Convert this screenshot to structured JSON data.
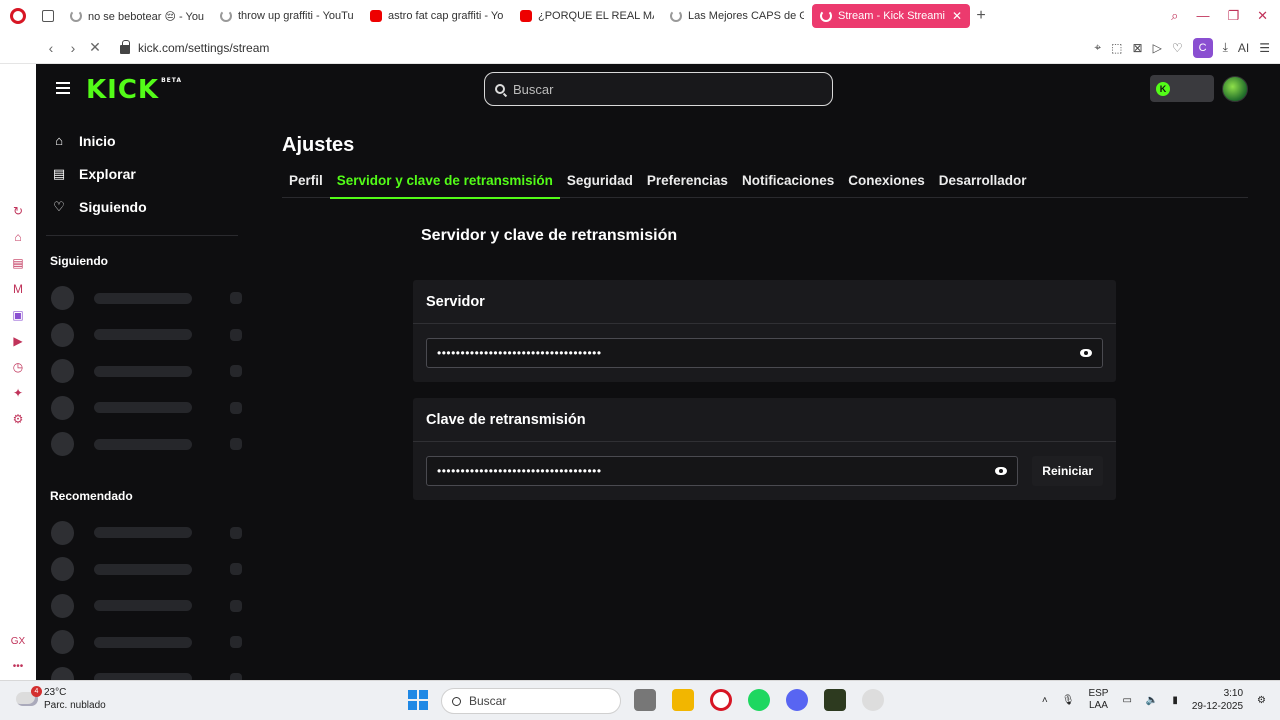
{
  "browser": {
    "tabs": [
      {
        "title": "no se bebotear 😔 - You",
        "icon": "spinner-icon",
        "active": false
      },
      {
        "title": "throw up graffiti - YouTu",
        "icon": "spinner-icon",
        "active": false
      },
      {
        "title": "astro fat cap graffiti - Yo",
        "icon": "youtube-icon",
        "active": false
      },
      {
        "title": "¿PORQUE EL REAL MAD",
        "icon": "youtube-icon",
        "active": false
      },
      {
        "title": "Las Mejores CAPS de G",
        "icon": "spinner-icon",
        "active": false
      },
      {
        "title": "Stream - Kick Streami",
        "icon": "spinner-icon",
        "active": true
      }
    ],
    "new_tab": "+",
    "tab_close": "✕",
    "url": "kick.com/settings/stream",
    "ai_label": "AI",
    "profile_letter": "C",
    "accent": "#ec3a6e"
  },
  "kick": {
    "logo": "KICK",
    "logo_badge": "BETA",
    "brand_color": "#53fc18",
    "search_placeholder": "Buscar",
    "nav": [
      {
        "label": "Inicio",
        "icon": "home-icon"
      },
      {
        "label": "Explorar",
        "icon": "explore-icon"
      },
      {
        "label": "Siguiendo",
        "icon": "heart-icon"
      }
    ],
    "following_heading": "Siguiendo",
    "recommended_heading": "Recomendado",
    "page_title": "Ajustes",
    "settings_tabs": [
      {
        "label": "Perfil",
        "active": false
      },
      {
        "label": "Servidor y clave de retransmisión",
        "active": true
      },
      {
        "label": "Seguridad",
        "active": false
      },
      {
        "label": "Preferencias",
        "active": false
      },
      {
        "label": "Notificaciones",
        "active": false
      },
      {
        "label": "Conexiones",
        "active": false
      },
      {
        "label": "Desarrollador",
        "active": false
      }
    ],
    "section_title": "Servidor y clave de retransmisión",
    "server": {
      "heading": "Servidor",
      "value": "•••••••••••••••••••••••••••••••••••"
    },
    "stream_key": {
      "heading": "Clave de retransmisión",
      "value": "•••••••••••••••••••••••••••••••••••",
      "reset_label": "Reiniciar"
    }
  },
  "taskbar": {
    "temperature": "23°C",
    "weather": "Parc. nublado",
    "weather_badge": "4",
    "search_label": "Buscar",
    "lang_top": "ESP",
    "lang_bottom": "LAA",
    "time": "3:10",
    "date": "29-12-2025"
  }
}
